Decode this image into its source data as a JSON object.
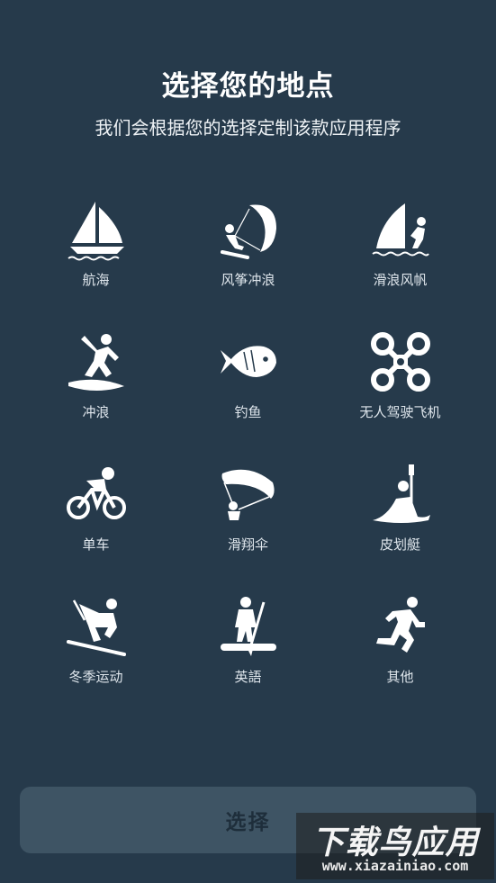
{
  "header": {
    "title": "选择您的地点",
    "subtitle": "我们会根据您的选择定制该款应用程序"
  },
  "activities": [
    {
      "label": "航海",
      "icon": "sailboat-icon"
    },
    {
      "label": "风筝冲浪",
      "icon": "kitesurf-icon"
    },
    {
      "label": "滑浪风帆",
      "icon": "windsurf-icon"
    },
    {
      "label": "冲浪",
      "icon": "surf-icon"
    },
    {
      "label": "钓鱼",
      "icon": "fish-icon"
    },
    {
      "label": "无人驾驶飞机",
      "icon": "drone-icon"
    },
    {
      "label": "单车",
      "icon": "bicycle-icon"
    },
    {
      "label": "滑翔伞",
      "icon": "paraglider-icon"
    },
    {
      "label": "皮划艇",
      "icon": "kayak-icon"
    },
    {
      "label": "冬季运动",
      "icon": "ski-icon"
    },
    {
      "label": "英語",
      "icon": "paddleboard-icon"
    },
    {
      "label": "其他",
      "icon": "running-icon"
    }
  ],
  "footer": {
    "select_label": "选择"
  },
  "watermark": {
    "text": "下载鸟应用",
    "url": "www.xiazainiao.com"
  },
  "colors": {
    "background": "#263a4b",
    "button": "#3e5464",
    "icon": "#ffffff"
  }
}
